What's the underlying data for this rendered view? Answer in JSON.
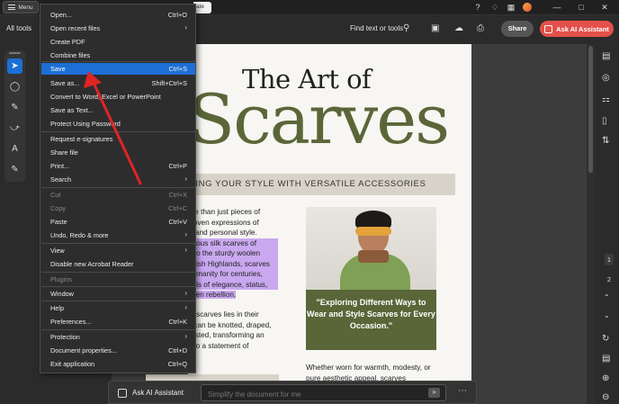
{
  "topbar": {
    "menu_label": "Menu",
    "peek_tab": "ate",
    "icons": [
      "help-icon",
      "bell-icon",
      "apps-icon"
    ],
    "window_controls": [
      "—",
      "□",
      "✕"
    ]
  },
  "toolbar": {
    "all_tools": "All tools",
    "find_text": "Find text or tools",
    "share": "Share",
    "ai_assistant": "Ask AI Assistant"
  },
  "left_tools": [
    "select-tool-icon",
    "comment-tool-icon",
    "pen-tool-icon",
    "lasso-tool-icon",
    "text-tool-icon",
    "stamp-tool-icon"
  ],
  "menu": {
    "items": [
      {
        "label": "Open...",
        "shortcut": "Ctrl+O"
      },
      {
        "label": "Open recent files",
        "submenu": true
      },
      {
        "label": "Create PDF"
      },
      {
        "label": "Combine files"
      },
      {
        "label": "Save",
        "shortcut": "Ctrl+S",
        "selected": true
      },
      {
        "label": "Save as...",
        "shortcut": "Shift+Ctrl+S"
      },
      {
        "label": "Convert to Word, Excel or PowerPoint"
      },
      {
        "label": "Save as Text..."
      },
      {
        "label": "Protect Using Password"
      },
      {
        "label": "Request e-signatures"
      },
      {
        "label": "Share file"
      },
      {
        "label": "Print...",
        "shortcut": "Ctrl+P"
      },
      {
        "label": "Search",
        "submenu": true
      },
      {
        "label": "Cut",
        "shortcut": "Ctrl+X",
        "disabled": true
      },
      {
        "label": "Copy",
        "shortcut": "Ctrl+C",
        "disabled": true
      },
      {
        "label": "Paste",
        "shortcut": "Ctrl+V"
      },
      {
        "label": "Undo, Redo & more",
        "submenu": true
      },
      {
        "label": "View",
        "submenu": true
      },
      {
        "label": "Disable new Acrobat Reader"
      },
      {
        "label": "Plugins",
        "disabled": true
      },
      {
        "label": "Window",
        "submenu": true
      },
      {
        "label": "Help",
        "submenu": true
      },
      {
        "label": "Preferences...",
        "shortcut": "Ctrl+K"
      },
      {
        "label": "Protection",
        "submenu": true
      },
      {
        "label": "Document properties...",
        "shortcut": "Ctrl+D"
      },
      {
        "label": "Exit application",
        "shortcut": "Ctrl+Q"
      }
    ]
  },
  "document": {
    "title_small": "The Art of",
    "title_big": "Scarves",
    "band_text": "TING YOUR STYLE WITH VERSATILE ACCESSORIES",
    "body_lines": [
      "ore than just pieces of",
      "woven expressions of",
      "y, and personal style.",
      "urious silk scarves of",
      "n to the sturdy woolen",
      "ottish Highlands, scarves",
      "humanity for centuries,",
      "bols of elegance, status,",
      "even rebellion."
    ],
    "body2_lines": [
      "of scarves lies in their",
      "y can be knotted, draped,",
      "wisted, transforming an",
      "into a statement of"
    ],
    "quote": "\"Exploring Different Ways to Wear and Style Scarves for Every Occasion.\"",
    "bottom_lines": [
      "Whether worn for warmth, modesty, or",
      "pure    aesthetic    appeal,    scarves"
    ]
  },
  "page_numbers": [
    "1",
    "2"
  ],
  "ai_bar": {
    "label": "Ask AI Assistant",
    "placeholder": "Simplify the document for me",
    "more": "⋯"
  },
  "colors": {
    "accent": "#1d6fd6",
    "ai_button": "#e4504a",
    "olive": "#5a6638",
    "highlight": "#c9a8f0",
    "arrow": "#e02424"
  }
}
